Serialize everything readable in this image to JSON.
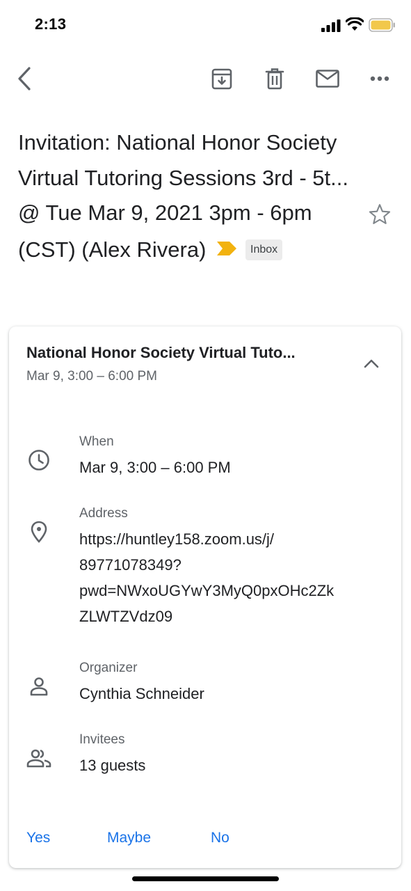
{
  "status_bar": {
    "time": "2:13"
  },
  "toolbar": {
    "back_icon": "chevron-left-icon",
    "archive_icon": "archive-icon",
    "delete_icon": "trash-icon",
    "mark_unread_icon": "mail-icon",
    "more_icon": "more-horizontal-icon"
  },
  "email": {
    "subject": "Invitation: National Honor Society Virtual Tutoring Sessions 3rd - 5t... @ Tue Mar 9, 2021 3pm - 6pm (CST) (Alex Rivera)",
    "label": "Inbox",
    "importance_color": "#f2b20f",
    "starred": false
  },
  "event_card": {
    "title": "National Honor Society Virtual Tuto...",
    "subtitle": "Mar 9, 3:00 – 6:00 PM",
    "when": {
      "label": "When",
      "value": "Mar 9, 3:00 – 6:00 PM"
    },
    "address": {
      "label": "Address",
      "lines": [
        "https://huntley158.zoom.us/j/",
        "89771078349?",
        "pwd=NWxoUGYwY3MyQ0pxOHc2Zk",
        "ZLWTZVdz09"
      ]
    },
    "organizer": {
      "label": "Organizer",
      "value": "Cynthia Schneider"
    },
    "invitees": {
      "label": "Invitees",
      "value": "13 guests"
    },
    "rsvp": {
      "yes": "Yes",
      "maybe": "Maybe",
      "no": "No"
    }
  },
  "colors": {
    "accent": "#1a73e8",
    "secondary_text": "#5f6368",
    "primary_text": "#202124"
  }
}
